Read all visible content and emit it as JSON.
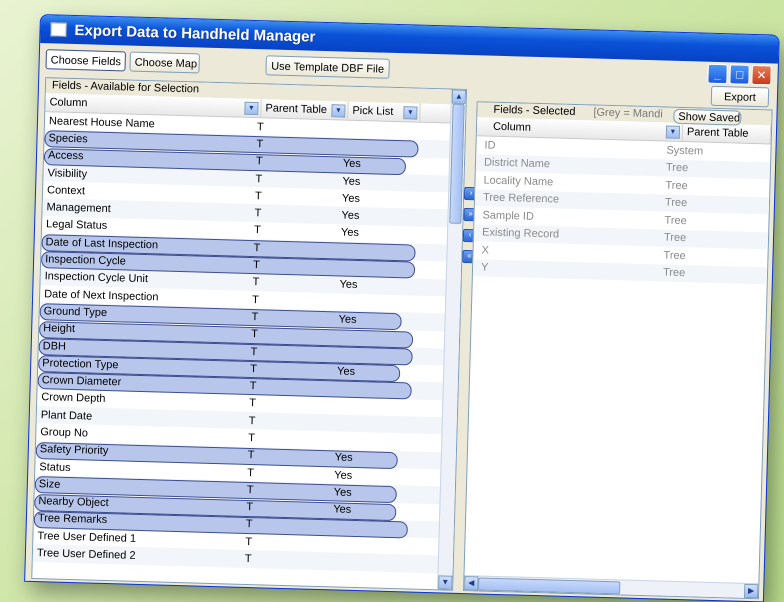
{
  "window": {
    "title": "Export Data to Handheld Manager"
  },
  "tabs": [
    {
      "label": "Choose Fields"
    },
    {
      "label": "Choose Map"
    }
  ],
  "toolbar": {
    "template_label": "Use Template DBF File",
    "export_label": "Export"
  },
  "left_panel": {
    "title": "Fields - Available for Selection",
    "columns": [
      "Column",
      "Parent Table",
      "Pick List"
    ],
    "rows": [
      {
        "name": "Nearest House Name",
        "parent": "T",
        "pick": "",
        "highlight": false
      },
      {
        "name": "Species",
        "parent": "T",
        "pick": "",
        "highlight": true
      },
      {
        "name": "Access",
        "parent": "T",
        "pick": "Yes",
        "highlight": true
      },
      {
        "name": "Visibility",
        "parent": "T",
        "pick": "Yes",
        "highlight": false
      },
      {
        "name": "Context",
        "parent": "T",
        "pick": "Yes",
        "highlight": false
      },
      {
        "name": "Management",
        "parent": "T",
        "pick": "Yes",
        "highlight": false
      },
      {
        "name": "Legal Status",
        "parent": "T",
        "pick": "Yes",
        "highlight": false
      },
      {
        "name": "Date of Last Inspection",
        "parent": "T",
        "pick": "",
        "highlight": true
      },
      {
        "name": "Inspection Cycle",
        "parent": "T",
        "pick": "",
        "highlight": true
      },
      {
        "name": "Inspection Cycle Unit",
        "parent": "T",
        "pick": "Yes",
        "highlight": false
      },
      {
        "name": "Date of Next Inspection",
        "parent": "T",
        "pick": "",
        "highlight": false
      },
      {
        "name": "Ground Type",
        "parent": "T",
        "pick": "Yes",
        "highlight": true
      },
      {
        "name": "Height",
        "parent": "T",
        "pick": "",
        "highlight": true
      },
      {
        "name": "DBH",
        "parent": "T",
        "pick": "",
        "highlight": true
      },
      {
        "name": "Protection Type",
        "parent": "T",
        "pick": "Yes",
        "highlight": true
      },
      {
        "name": "Crown Diameter",
        "parent": "T",
        "pick": "",
        "highlight": true
      },
      {
        "name": "Crown Depth",
        "parent": "T",
        "pick": "",
        "highlight": false
      },
      {
        "name": "Plant Date",
        "parent": "T",
        "pick": "",
        "highlight": false
      },
      {
        "name": "Group No",
        "parent": "T",
        "pick": "",
        "highlight": false
      },
      {
        "name": "Safety Priority",
        "parent": "T",
        "pick": "Yes",
        "highlight": true
      },
      {
        "name": "Status",
        "parent": "T",
        "pick": "Yes",
        "highlight": false
      },
      {
        "name": "Size",
        "parent": "T",
        "pick": "Yes",
        "highlight": true
      },
      {
        "name": "Nearby Object",
        "parent": "T",
        "pick": "Yes",
        "highlight": true
      },
      {
        "name": "Tree Remarks",
        "parent": "T",
        "pick": "",
        "highlight": true
      },
      {
        "name": "Tree User Defined 1",
        "parent": "T",
        "pick": "",
        "highlight": false
      },
      {
        "name": "Tree User Defined 2",
        "parent": "T",
        "pick": "",
        "highlight": false
      }
    ]
  },
  "right_panel": {
    "title": "Fields - Selected",
    "note": "[Grey = Mandi",
    "show_saved_label": "Show Saved",
    "columns": [
      "Column",
      "Parent Table"
    ],
    "rows": [
      {
        "name": "ID",
        "parent": "System"
      },
      {
        "name": "District Name",
        "parent": "Tree"
      },
      {
        "name": "Locality Name",
        "parent": "Tree"
      },
      {
        "name": "Tree Reference",
        "parent": "Tree"
      },
      {
        "name": "Sample ID",
        "parent": "Tree"
      },
      {
        "name": "Existing Record",
        "parent": "Tree"
      },
      {
        "name": "X",
        "parent": "Tree"
      },
      {
        "name": "Y",
        "parent": "Tree"
      }
    ]
  }
}
